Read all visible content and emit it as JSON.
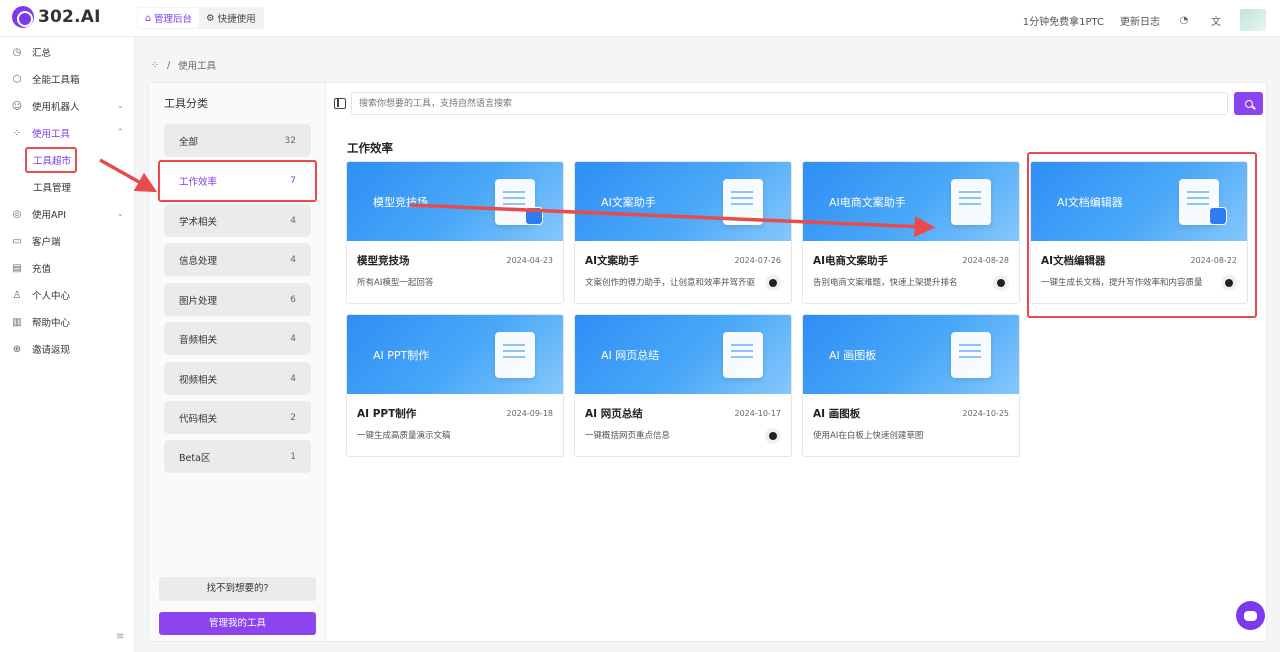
{
  "app": {
    "logo_text": "302.AI"
  },
  "topnav": [
    {
      "label": "管理后台",
      "icon": "home-icon",
      "active": true
    },
    {
      "label": "快捷使用",
      "icon": "gear-icon",
      "active": false
    }
  ],
  "topright": {
    "promo": "1分钟免费拿1PTC",
    "changelog": "更新日志"
  },
  "sidebar": {
    "items": [
      {
        "label": "汇总",
        "icon": "dashboard-icon"
      },
      {
        "label": "全能工具箱",
        "icon": "cube-icon"
      },
      {
        "label": "使用机器人",
        "icon": "robot-icon"
      },
      {
        "label": "使用工具",
        "icon": "grid-icon"
      },
      {
        "label": "使用API",
        "icon": "api-icon"
      },
      {
        "label": "客户端",
        "icon": "monitor-icon"
      },
      {
        "label": "充值",
        "icon": "wallet-icon"
      },
      {
        "label": "个人中心",
        "icon": "user-icon"
      },
      {
        "label": "帮助中心",
        "icon": "book-icon"
      },
      {
        "label": "邀请返现",
        "icon": "gift-icon"
      }
    ],
    "sub": [
      {
        "label": "工具超市",
        "active": true
      },
      {
        "label": "工具管理",
        "active": false
      }
    ]
  },
  "breadcrumb": {
    "current": "使用工具"
  },
  "categories": {
    "title": "工具分类",
    "items": [
      {
        "label": "全部",
        "count": "32"
      },
      {
        "label": "工作效率",
        "count": "7",
        "active": true
      },
      {
        "label": "学术相关",
        "count": "4"
      },
      {
        "label": "信息处理",
        "count": "4"
      },
      {
        "label": "图片处理",
        "count": "6"
      },
      {
        "label": "音频相关",
        "count": "4"
      },
      {
        "label": "视频相关",
        "count": "4"
      },
      {
        "label": "代码相关",
        "count": "2"
      },
      {
        "label": "Beta区",
        "count": "1"
      }
    ],
    "cant_find": "找不到想要的?",
    "manage": "管理我的工具"
  },
  "search": {
    "placeholder": "搜索你想要的工具，支持自然语言搜索"
  },
  "section": {
    "title": "工作效率"
  },
  "tools": [
    {
      "banner": "模型竞技场",
      "name": "模型竞技场",
      "date": "2024-04-23",
      "desc": "所有AI模型一起回答",
      "github": false
    },
    {
      "banner": "AI文案助手",
      "name": "AI文案助手",
      "date": "2024-07-26",
      "desc": "文案创作的得力助手，让创意和效率并驾齐驱",
      "github": true
    },
    {
      "banner": "AI电商文案助手",
      "name": "AI电商文案助手",
      "date": "2024-08-28",
      "desc": "告别电商文案难题，快速上架提升排名",
      "github": true
    },
    {
      "banner": "AI文档编辑器",
      "name": "AI文档编辑器",
      "date": "2024-08-22",
      "desc": "一键生成长文档，提升写作效率和内容质量",
      "github": true
    },
    {
      "banner": "AI PPT制作",
      "name": "AI PPT制作",
      "date": "2024-09-18",
      "desc": "一键生成高质量演示文稿",
      "github": false
    },
    {
      "banner": "AI 网页总结",
      "name": "AI 网页总结",
      "date": "2024-10-17",
      "desc": "一键概括网页重点信息",
      "github": true
    },
    {
      "banner": "AI 画图板",
      "name": "AI 画图板",
      "date": "2024-10-25",
      "desc": "使用AI在白板上快速创建草图",
      "github": false
    }
  ],
  "colors": {
    "accent": "#8b44f0",
    "annotation": "#e84b4b",
    "banner": "#2e8ef5"
  }
}
